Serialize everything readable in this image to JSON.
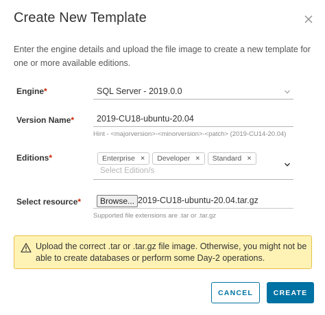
{
  "dialog": {
    "title": "Create New Template",
    "intro": "Enter the engine details and upload the file image to create a new template for one or more available editions."
  },
  "form": {
    "engine": {
      "label": "Engine",
      "required_mark": "*",
      "value": "SQL Server - 2019.0.0"
    },
    "version_name": {
      "label": "Version Name",
      "required_mark": "*",
      "value": "2019-CU18-ubuntu-20.04",
      "hint": "Hint - <majorversion>-<minorversion>-<patch> (2019-CU14-20.04)"
    },
    "editions": {
      "label": "Editions",
      "required_mark": "*",
      "selected": [
        "Enterprise",
        "Developer",
        "Standard"
      ],
      "remove_glyph": "×",
      "placeholder": "Select Edition/s"
    },
    "resource": {
      "label": "Select resource",
      "required_mark": "*",
      "browse_label": "Browse...",
      "file_name": "2019-CU18-ubuntu-20.04.tar.gz",
      "hint": "Supported file extensions are .tar or .tar.gz"
    }
  },
  "alert": {
    "text": "Upload the correct .tar or .tar.gz file image. Otherwise, you might not be able to create databases or perform some Day-2 operations.",
    "icon": "warning-triangle-icon"
  },
  "actions": {
    "cancel_label": "CANCEL",
    "create_label": "CREATE"
  },
  "colors": {
    "primary": "#0072a3",
    "required": "#c92100",
    "warning_bg": "#fef3b5",
    "warning_border": "#e7c14a"
  }
}
